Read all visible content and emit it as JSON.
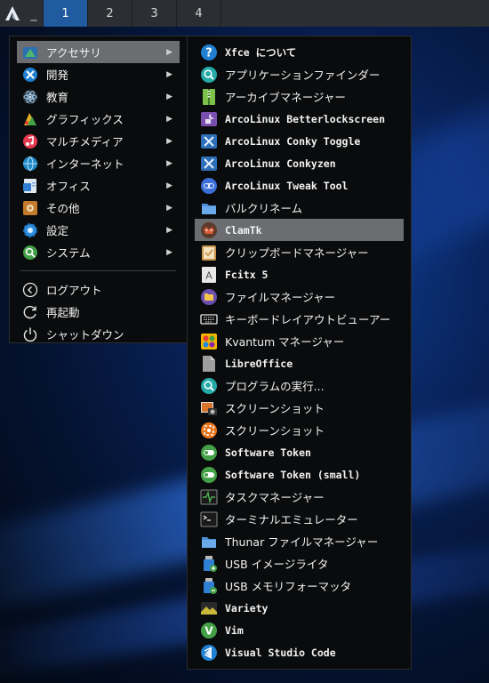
{
  "panel": {
    "dash": "_",
    "workspaces": [
      "1",
      "2",
      "3",
      "4"
    ],
    "active_workspace": "1"
  },
  "main_menu": {
    "categories": [
      {
        "label": "アクセサリ",
        "icon": "accessories-icon",
        "highlighted": true
      },
      {
        "label": "開発",
        "icon": "development-icon"
      },
      {
        "label": "教育",
        "icon": "education-icon"
      },
      {
        "label": "グラフィックス",
        "icon": "graphics-icon"
      },
      {
        "label": "マルチメディア",
        "icon": "multimedia-icon"
      },
      {
        "label": "インターネット",
        "icon": "internet-icon"
      },
      {
        "label": "オフィス",
        "icon": "office-icon"
      },
      {
        "label": "その他",
        "icon": "other-icon"
      },
      {
        "label": "設定",
        "icon": "settings-icon"
      },
      {
        "label": "システム",
        "icon": "system-icon"
      }
    ],
    "actions": [
      {
        "label": "ログアウト",
        "icon": "logout-icon"
      },
      {
        "label": "再起動",
        "icon": "restart-icon"
      },
      {
        "label": "シャットダウン",
        "icon": "shutdown-icon"
      }
    ],
    "arrow": "▶"
  },
  "sub_menu": {
    "items": [
      {
        "label": "Xfce について",
        "icon": "info-icon"
      },
      {
        "label": "アプリケーションファインダー",
        "icon": "app-finder-icon"
      },
      {
        "label": "アーカイブマネージャー",
        "icon": "archive-manager-icon"
      },
      {
        "label": "ArcoLinux Betterlockscreen",
        "icon": "lockscreen-icon"
      },
      {
        "label": "ArcoLinux Conky Toggle",
        "icon": "conky-icon"
      },
      {
        "label": "ArcoLinux Conkyzen",
        "icon": "conkyzen-icon"
      },
      {
        "label": "ArcoLinux Tweak Tool",
        "icon": "tweak-tool-icon"
      },
      {
        "label": "バルクリネーム",
        "icon": "bulk-rename-icon"
      },
      {
        "label": "ClamTk",
        "icon": "clamtk-icon",
        "highlighted": true
      },
      {
        "label": "クリップボードマネージャー",
        "icon": "clipboard-icon"
      },
      {
        "label": "Fcitx 5",
        "icon": "fcitx-icon"
      },
      {
        "label": "ファイルマネージャー",
        "icon": "file-manager-icon"
      },
      {
        "label": "キーボードレイアウトビューアー",
        "icon": "keyboard-icon"
      },
      {
        "label": "Kvantum マネージャー",
        "icon": "kvantum-icon"
      },
      {
        "label": "LibreOffice",
        "icon": "libreoffice-icon"
      },
      {
        "label": "プログラムの実行...",
        "icon": "run-program-icon"
      },
      {
        "label": "スクリーンショット",
        "icon": "screenshot-camera-icon"
      },
      {
        "label": "スクリーンショット",
        "icon": "screenshot-tool-icon"
      },
      {
        "label": "Software Token",
        "icon": "software-token-icon"
      },
      {
        "label": "Software Token (small)",
        "icon": "software-token-small-icon"
      },
      {
        "label": "タスクマネージャー",
        "icon": "task-manager-icon"
      },
      {
        "label": "ターミナルエミュレーター",
        "icon": "terminal-icon"
      },
      {
        "label": "Thunar ファイルマネージャー",
        "icon": "thunar-icon"
      },
      {
        "label": "USB イメージライタ",
        "icon": "usb-writer-icon"
      },
      {
        "label": "USB メモリフォーマッタ",
        "icon": "usb-formatter-icon"
      },
      {
        "label": "Variety",
        "icon": "variety-icon"
      },
      {
        "label": "Vim",
        "icon": "vim-icon"
      },
      {
        "label": "Visual Studio Code",
        "icon": "vscode-icon"
      }
    ]
  }
}
